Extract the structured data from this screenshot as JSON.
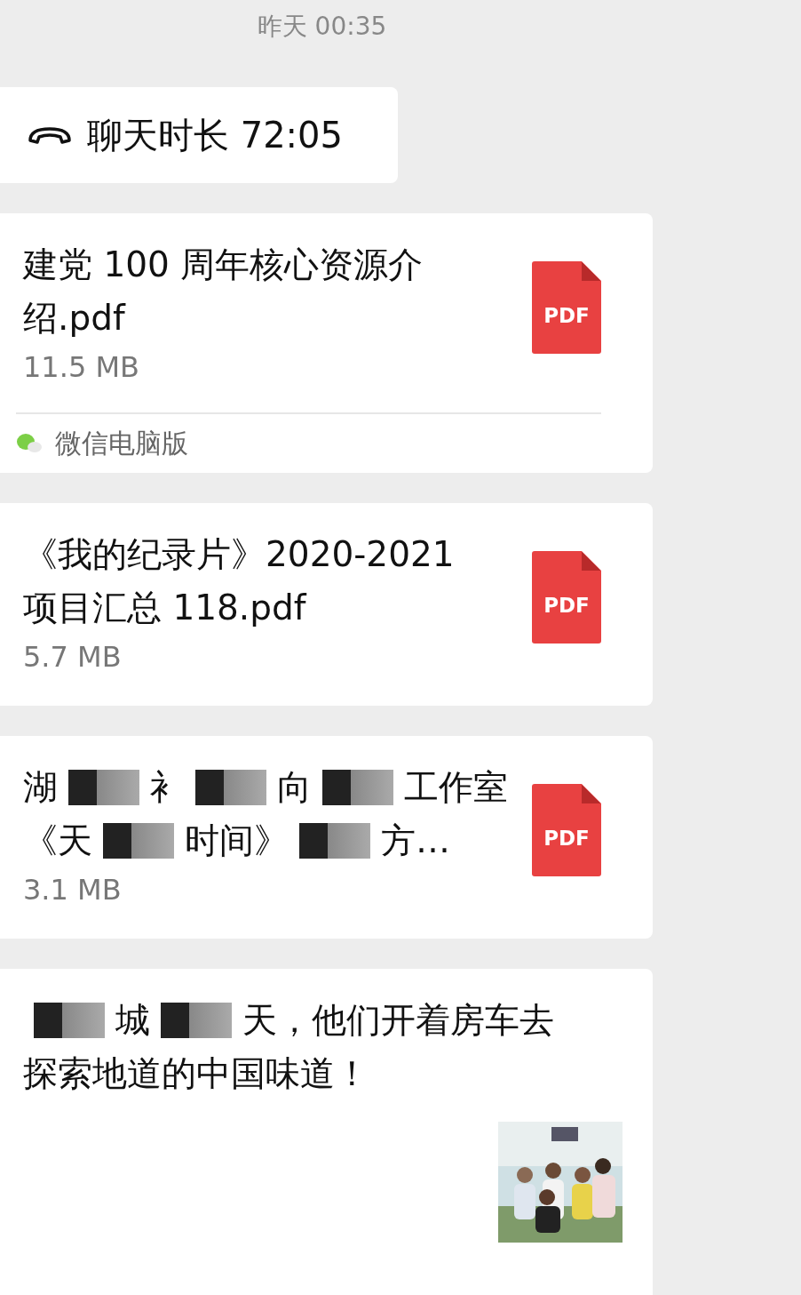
{
  "timestamp": "昨天 00:35",
  "call": {
    "label": "聊天时长 72:05"
  },
  "messages": [
    {
      "kind": "file",
      "title_lines": [
        [
          {
            "kind": "text",
            "text": "建党 100 周年核心资源介"
          }
        ],
        [
          {
            "kind": "text",
            "text": "绍.pdf"
          }
        ]
      ],
      "size": "11.5 MB",
      "file_type": "PDF",
      "source": "微信电脑版"
    },
    {
      "kind": "file",
      "title_lines": [
        [
          {
            "kind": "text",
            "text": "《我的纪录片》2020-2021"
          }
        ],
        [
          {
            "kind": "text",
            "text": "项目汇总 118.pdf"
          }
        ]
      ],
      "size": "5.7 MB",
      "file_type": "PDF"
    },
    {
      "kind": "file",
      "title_lines": [
        [
          {
            "kind": "text",
            "text": "湖"
          },
          {
            "kind": "redacted"
          },
          {
            "kind": "text",
            "text": "衤"
          },
          {
            "kind": "redacted"
          },
          {
            "kind": "text",
            "text": "向"
          },
          {
            "kind": "redacted"
          },
          {
            "kind": "text",
            "text": "工作室"
          }
        ],
        [
          {
            "kind": "text",
            "text": "《天"
          },
          {
            "kind": "redacted"
          },
          {
            "kind": "text",
            "text": "时间》"
          },
          {
            "kind": "redacted"
          },
          {
            "kind": "text",
            "text": "方…"
          }
        ]
      ],
      "size": "3.1 MB",
      "file_type": "PDF"
    },
    {
      "kind": "link",
      "title_lines": [
        [
          {
            "kind": "redacted"
          },
          {
            "kind": "text",
            "text": "城"
          },
          {
            "kind": "redacted"
          },
          {
            "kind": "text",
            "text": "天，他们开着房车去"
          }
        ],
        [
          {
            "kind": "text",
            "text": "探索地道的中国味道！"
          }
        ]
      ],
      "thumbnail": {
        "kind": "picture"
      }
    }
  ]
}
